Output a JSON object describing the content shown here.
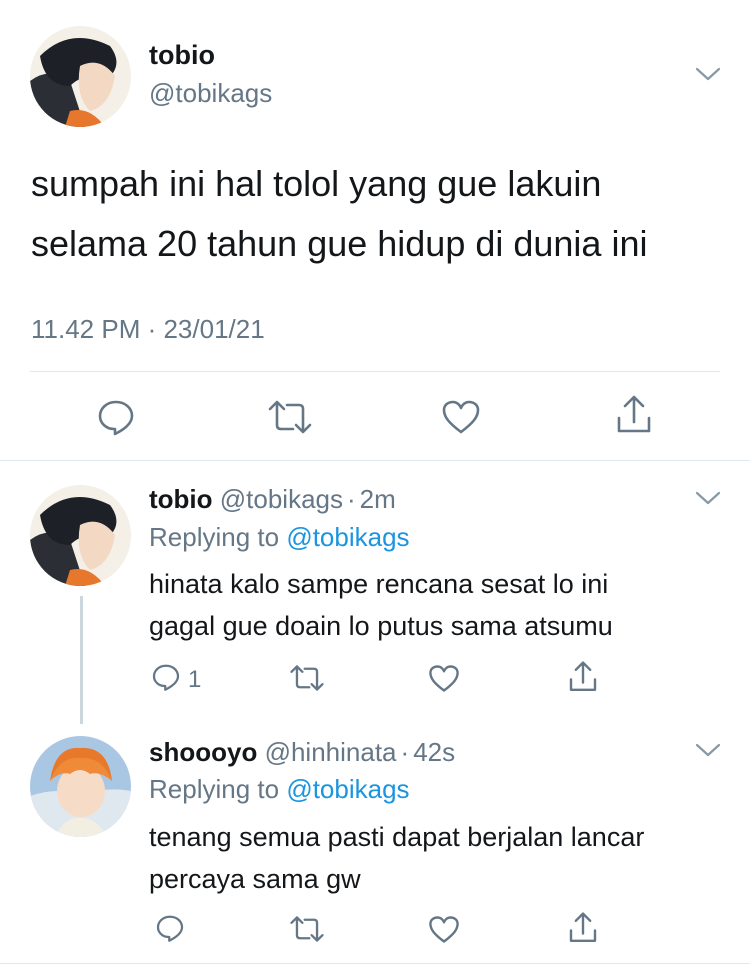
{
  "main_tweet": {
    "display_name": "tobio",
    "handle": "@tobikags",
    "text_line1": "sumpah ini hal tolol yang gue lakuin",
    "text_line2": "selama 20 tahun gue hidup di dunia ini",
    "timestamp": "11.42 PM · 23/01/21",
    "actions": [
      "reply-icon",
      "retweet-icon",
      "like-icon",
      "share-icon"
    ]
  },
  "replies": [
    {
      "display_name": "tobio",
      "handle": "@tobikags",
      "separator": "·",
      "time": "2m",
      "replying_prefix": "Replying to",
      "replying_to": "@tobikags",
      "text_line1": "hinata kalo sampe rencana sesat lo ini",
      "text_line2": "gagal gue doain lo putus sama atsumu",
      "reply_count": "1"
    },
    {
      "display_name": "shoooyo",
      "handle": "@hinhinata",
      "separator": "·",
      "time": "42s",
      "replying_prefix": "Replying to",
      "replying_to": "@tobikags",
      "text_line1": "tenang semua pasti dapat berjalan lancar",
      "text_line2": "percaya sama gw",
      "reply_count": ""
    }
  ],
  "colors": {
    "link": "#1b95e0",
    "muted": "#657786",
    "divider": "#e1e8ed",
    "thread_line": "#ccd6dd"
  }
}
